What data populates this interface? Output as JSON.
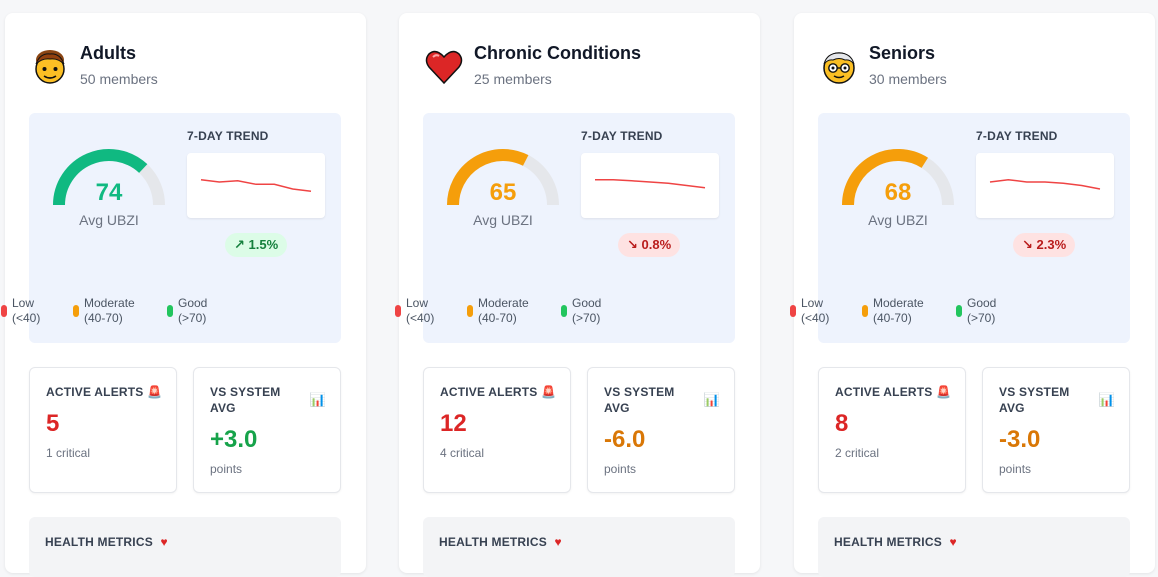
{
  "legend": {
    "low_label": "Low",
    "low_range": "(<40)",
    "moderate_label": "Moderate",
    "moderate_range": "(40-70)",
    "good_label": "Good",
    "good_range": "(>70)",
    "colors": {
      "low": "#ef4444",
      "moderate": "#f59e0b",
      "good": "#22c55e"
    }
  },
  "labels": {
    "trend_title": "7-DAY TREND",
    "avg_label": "Avg UBZI",
    "alerts_title": "ACTIVE ALERTS",
    "vs_title_line1": "VS SYSTEM",
    "vs_title_line2": "AVG",
    "vs_unit": "points",
    "metrics_title": "HEALTH METRICS"
  },
  "icons": {
    "alerts": "🚨",
    "vs": "📊",
    "metrics": "❤️"
  },
  "groups": [
    {
      "name": "Adults",
      "members": "50 members",
      "icon": "adult-face-icon",
      "avg_ubzi": 74,
      "avg_display": "74",
      "gauge_color": "#10b981",
      "trend_pct": "↗ 1.5%",
      "trend_direction": "up",
      "trend_series": [
        60,
        58,
        59,
        56,
        56,
        52,
        50
      ],
      "alerts_count": "5",
      "alerts_sub": "1 critical",
      "vs_value": "+3.0",
      "vs_color": "#16a34a"
    },
    {
      "name": "Chronic Conditions",
      "members": "25 members",
      "icon": "heart-icon",
      "avg_ubzi": 65,
      "avg_display": "65",
      "gauge_color": "#f59e0b",
      "trend_pct": "↘ 0.8%",
      "trend_direction": "down",
      "trend_series": [
        60,
        60,
        59,
        58,
        57,
        55,
        53
      ],
      "alerts_count": "12",
      "alerts_sub": "4 critical",
      "vs_value": "-6.0",
      "vs_color": "#d97706"
    },
    {
      "name": "Seniors",
      "members": "30 members",
      "icon": "older-face-icon",
      "avg_ubzi": 68,
      "avg_display": "68",
      "gauge_color": "#f59e0b",
      "trend_pct": "↘ 2.3%",
      "trend_direction": "down",
      "trend_series": [
        58,
        60,
        58,
        58,
        57,
        55,
        52
      ],
      "alerts_count": "8",
      "alerts_sub": "2 critical",
      "vs_value": "-3.0",
      "vs_color": "#d97706"
    }
  ]
}
